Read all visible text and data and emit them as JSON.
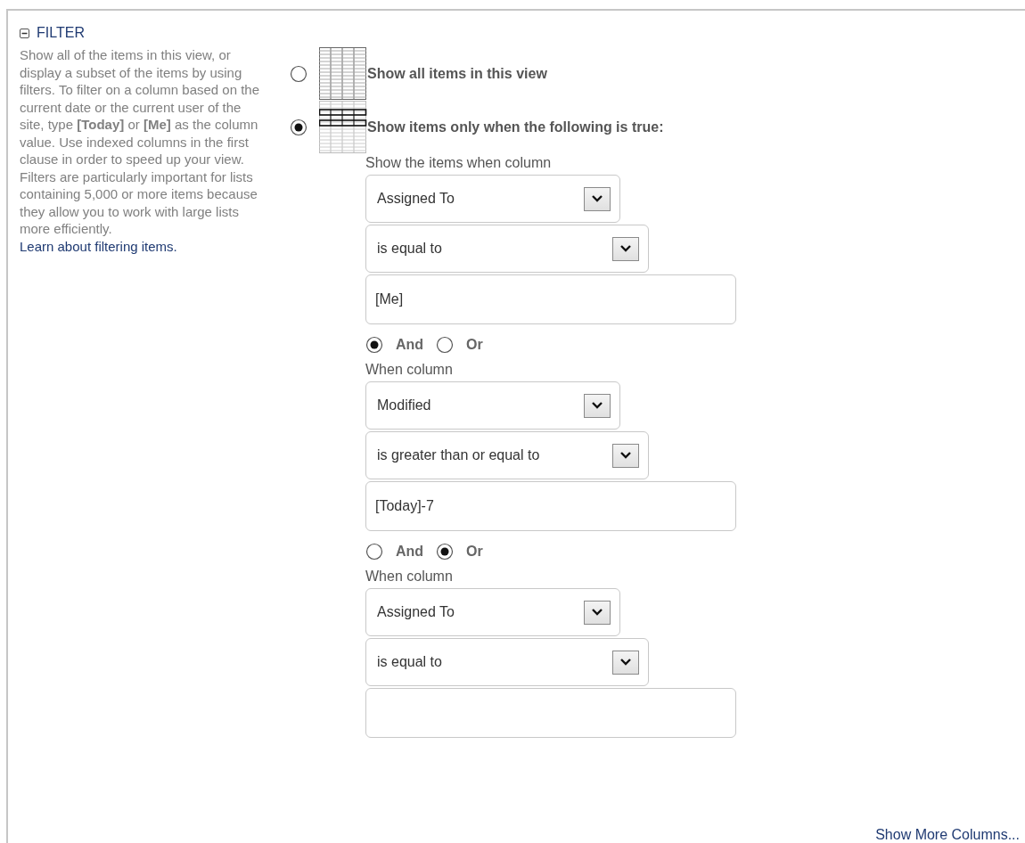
{
  "section": {
    "title": "FILTER",
    "expanded": true
  },
  "description": "Show all of the items in this view, or display a subset of the items by using filters. To filter on a column based on the current date or the current user of the site, type **[Today]** or **[Me]** as the column value. Use indexed columns in the first clause in order to speed up your view. Filters are particularly important for lists containing 5,000 or more items because they allow you to work with large lists more efficiently.",
  "learn_link": "Learn about filtering items.",
  "scope_options": [
    {
      "kind": "all",
      "label": "Show all items in this view",
      "selected": false
    },
    {
      "kind": "filtered",
      "label": "Show items only when the following is true:",
      "selected": true
    }
  ],
  "clauses": [
    {
      "label": "Show the items when column",
      "column": "Assigned To",
      "operator": "is equal to",
      "value": "[Me]",
      "connectors": [
        {
          "label": "And",
          "selected": true
        },
        {
          "label": "Or",
          "selected": false
        }
      ]
    },
    {
      "label": "When column",
      "column": "Modified",
      "operator": "is greater than or equal to",
      "value": "[Today]-7",
      "connectors": [
        {
          "label": "And",
          "selected": false
        },
        {
          "label": "Or",
          "selected": true
        }
      ]
    },
    {
      "label": "When column",
      "column": "Assigned To",
      "operator": "is equal to"
    }
  ],
  "more_link": "Show More Columns..."
}
